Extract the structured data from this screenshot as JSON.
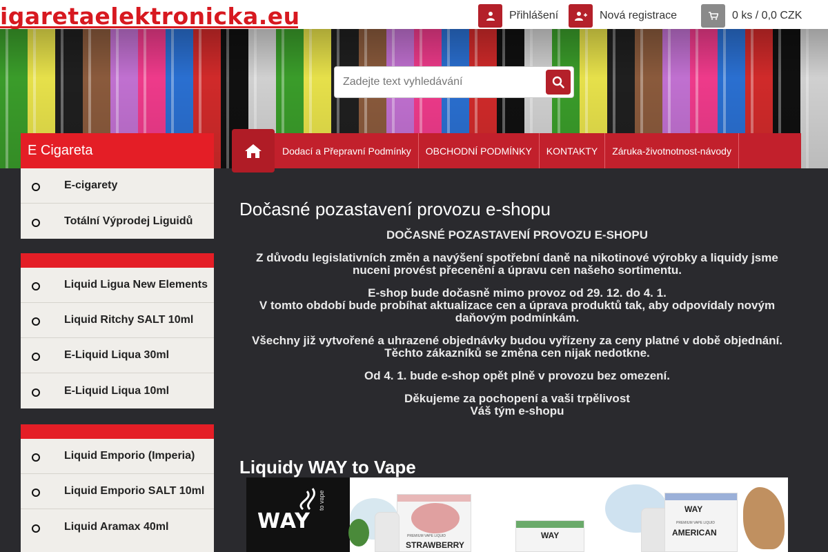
{
  "header": {
    "logo": "igaretaelektronicka.eu",
    "login_label": "Přihlášení",
    "register_label": "Nová registrace",
    "cart_label": "0 ks / 0,0 CZK"
  },
  "search": {
    "placeholder": "Zadejte text vyhledávání"
  },
  "sidebar": {
    "heading": "E Cigareta",
    "groups": [
      {
        "items": [
          "E-cigarety",
          "Totální Výprodej Liguidů"
        ]
      },
      {
        "items": [
          "Liquid Ligua New Elements",
          "Liquid Ritchy SALT 10ml",
          "E-Liquid Liqua 30ml",
          "E-Liquid Liqua 10ml"
        ]
      },
      {
        "items": [
          "Liquid Emporio (Imperia)",
          "Liquid Emporio SALT 10ml",
          "Liquid Aramax 40ml"
        ]
      }
    ]
  },
  "nav": {
    "items": [
      "Dodací a Přepravní Podmínky",
      "OBCHODNÍ PODMÍNKY",
      "KONTAKTY",
      "Záruka-životnotnost-návody"
    ]
  },
  "main": {
    "title": "Dočasné pozastavení provozu e-shopu",
    "notice": {
      "heading": "DOČASNÉ POZASTAVENÍ PROVOZU E-SHOPU",
      "p1": "Z důvodu legislativních změn a navýšení spotřební daně na nikotinové výrobky a liquidy jsme nuceni provést přecenění a úpravu cen našeho sortimentu.",
      "p2a": "E-shop bude dočasně mimo provoz od 29. 12. do 4. 1.",
      "p2b": "V tomto období bude probíhat aktualizace cen a úprava produktů tak, aby odpovídaly novým daňovým podmínkám.",
      "p3a": "Všechny již vytvořené a uhrazené objednávky budou vyřízeny za ceny platné v době objednání.",
      "p3b": "Těchto zákazníků se změna cen nijak nedotkne.",
      "p4": "Od 4. 1. bude e-shop opět plně v provozu bez omezení.",
      "p5a": "Děkujeme za pochopení a vaši trpělivost",
      "p5b": "Váš tým e-shopu"
    },
    "section_title": "Liquidy WAY to Vape",
    "promo": {
      "brand": "WAY",
      "brand_sub": "to vape",
      "small_text": "PREMIUM VAPE LIQUID",
      "box1": "STRAWBERRY",
      "box2": "WAY",
      "box3": "AMERICAN"
    }
  },
  "colors": {
    "accent": "#c2202c",
    "brand_red": "#e41e26",
    "background": "#2a2a2e"
  },
  "icons": {
    "login": "user-icon",
    "register": "user-plus-icon",
    "cart": "cart-icon",
    "search": "search-icon",
    "home": "home-icon"
  }
}
